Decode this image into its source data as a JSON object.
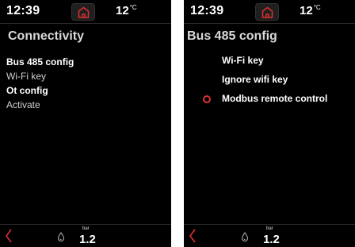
{
  "colors": {
    "accent": "#e03030",
    "background": "#000000"
  },
  "left_screen": {
    "time": "12:39",
    "temperature": "12",
    "temperature_unit": "°C",
    "title": "Connectivity",
    "menu": [
      {
        "label": "Bus 485 config",
        "state": "highlighted"
      },
      {
        "label": "Wi-Fi key",
        "state": "normal"
      },
      {
        "label": "Ot config",
        "state": "highlighted"
      },
      {
        "label": "Activate",
        "state": "normal"
      }
    ],
    "pressure_unit": "bar",
    "pressure": "1.2",
    "icons": [
      "home-icon",
      "back-icon",
      "water-drop-icon"
    ]
  },
  "right_screen": {
    "time": "12:39",
    "temperature": "12",
    "temperature_unit": "°C",
    "title": "Bus 485 config",
    "options": [
      {
        "label": "Wi-Fi key",
        "selected": false
      },
      {
        "label": "Ignore wifi key",
        "selected": false
      },
      {
        "label": "Modbus remote control",
        "selected": true
      }
    ],
    "pressure_unit": "bar",
    "pressure": "1.2",
    "icons": [
      "home-icon",
      "back-icon",
      "water-drop-icon",
      "radio-selected-icon"
    ]
  }
}
